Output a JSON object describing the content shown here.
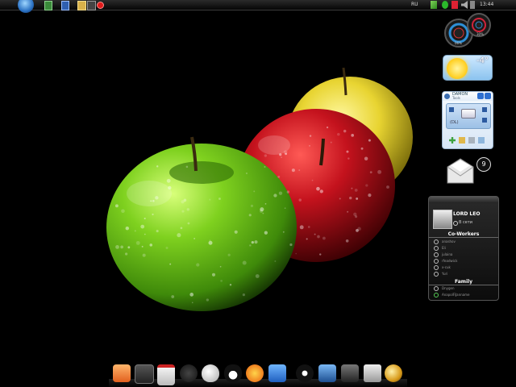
{
  "taskbar": {
    "language": "RU",
    "clock": "13:44"
  },
  "gadgets": {
    "meters": {
      "cpu": "06%",
      "ram": "30%"
    },
    "weather": {
      "temperature": "-4°"
    },
    "damon": {
      "brand": "DAMON",
      "subtitle": "Tools",
      "drive_code": "(DL)"
    },
    "mail": {
      "unread": "9"
    },
    "contacts": {
      "user_name": "LORD LEO",
      "user_status": "В сети",
      "groups": [
        {
          "title": "Co-Workers",
          "members": [
            "anashov",
            "Eli",
            "julaina",
            "rfeadwick",
            "x-cuk",
            "Yuri"
          ]
        },
        {
          "title": "Family",
          "members": [
            "Dnygen",
            "AnapolFiJanname"
          ]
        }
      ]
    }
  },
  "dock": {
    "items": [
      "packages-icon",
      "terminal-icon",
      "floppy-icon",
      "piano-icon",
      "theater-mask-icon",
      "penguin-icon",
      "fox-icon",
      "box-icon",
      "settings-dial-icon",
      "monitor-icon",
      "camera-icon",
      "lock-icon",
      "orb-icon"
    ]
  },
  "colors": {
    "green_apple": "#6fc21a",
    "red_apple": "#b9121b",
    "yellow_apple": "#e8d431"
  }
}
